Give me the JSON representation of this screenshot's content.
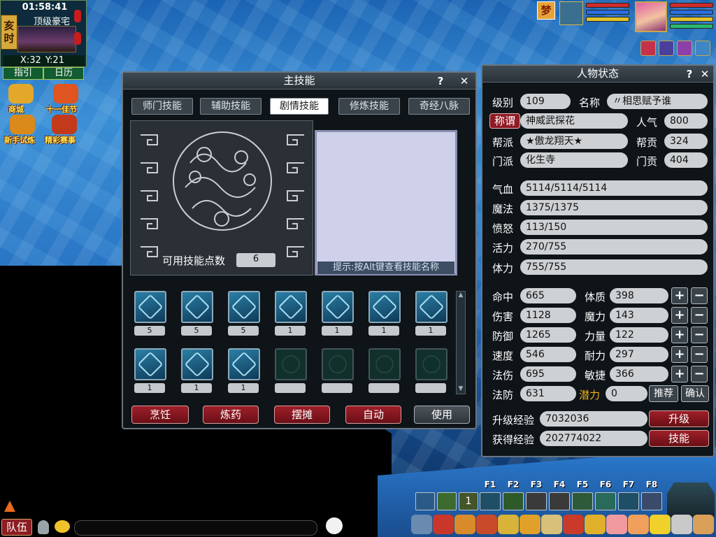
{
  "hud": {
    "clock": "01:58:41",
    "map_name": "顶级豪宅",
    "time_period": [
      "亥",
      "时"
    ],
    "coords_x": "X:32",
    "coords_y": "Y:21",
    "guide_label": "指引",
    "calendar_label": "日历",
    "activities": [
      {
        "label": "商城",
        "icon": "mall-icon",
        "color": "#e3a82a"
      },
      {
        "label": "十一佳节",
        "icon": "lantern-icon",
        "color": "#e0541f"
      },
      {
        "label": "新手试炼",
        "icon": "pagoda-icon",
        "color": "#d98a1a"
      },
      {
        "label": "精彩赛事",
        "icon": "drum-icon",
        "color": "#c23a1a"
      }
    ]
  },
  "status_top": {
    "pet_badge": "梦",
    "bar_colors": [
      "#d22b2b",
      "#2b6fe0",
      "#e3c32a"
    ],
    "shortcut_colors": [
      "#c4314b",
      "#4a3f9b",
      "#8c3fa8",
      "#3f86c4"
    ]
  },
  "skills_window": {
    "title": "主技能",
    "help": "?",
    "close": "✕",
    "tabs": [
      "师门技能",
      "辅助技能",
      "剧情技能",
      "修炼技能",
      "奇经八脉"
    ],
    "active_tab": "剧情技能",
    "points_label": "可用技能点数",
    "points_value": "6",
    "hint": "提示:按Alt键查看技能名称",
    "skill_levels_row1": [
      "5",
      "5",
      "5",
      "1",
      "1",
      "1",
      "1"
    ],
    "skill_levels_row2": [
      "1",
      "1",
      "1",
      "",
      "",
      "",
      ""
    ],
    "skill_icons_row1": [
      "skill-glyph-1-icon",
      "skill-glyph-2-icon",
      "skill-glyph-3-icon",
      "skill-glyph-4-icon",
      "skill-glyph-5-icon",
      "skill-glyph-6-icon",
      "skill-glyph-7-icon"
    ],
    "skill_icons_row2": [
      "sword-skill-icon",
      "wings-skill-icon",
      "tower-skill-icon",
      "empty-slot-icon",
      "empty-slot-icon",
      "empty-slot-icon",
      "empty-slot-icon"
    ],
    "buttons": [
      "烹饪",
      "炼药",
      "摆摊",
      "自动"
    ],
    "use_button": "使用"
  },
  "character_window": {
    "title": "人物状态",
    "help": "?",
    "close": "✕",
    "level_label": "级别",
    "level": "109",
    "name_label": "名称",
    "name": "〃相思赋予谁",
    "title_btn": "称谓",
    "title_value": "神威武探花",
    "popularity_label": "人气",
    "popularity": "800",
    "guild_label": "帮派",
    "guild": "★傲龙翔天★",
    "guild_contrib_label": "帮贡",
    "guild_contrib": "324",
    "sect_label": "门派",
    "sect": "化生寺",
    "sect_contrib_label": "门贡",
    "sect_contrib": "404",
    "hp_label": "气血",
    "hp": "5114/5114/5114",
    "mp_label": "魔法",
    "mp": "1375/1375",
    "rage_label": "愤怒",
    "rage": "113/150",
    "vitality_label": "活力",
    "vitality": "270/755",
    "stamina_label": "体力",
    "stamina": "755/755",
    "stats_left": [
      {
        "label": "命中",
        "value": "665"
      },
      {
        "label": "伤害",
        "value": "1128"
      },
      {
        "label": "防御",
        "value": "1265"
      },
      {
        "label": "速度",
        "value": "546"
      },
      {
        "label": "法伤",
        "value": "695"
      },
      {
        "label": "法防",
        "value": "631"
      }
    ],
    "attrs_right": [
      {
        "label": "体质",
        "value": "398"
      },
      {
        "label": "魔力",
        "value": "143"
      },
      {
        "label": "力量",
        "value": "122"
      },
      {
        "label": "耐力",
        "value": "297"
      },
      {
        "label": "敏捷",
        "value": "366"
      }
    ],
    "plus": "+",
    "minus": "−",
    "potential_label": "潜力",
    "potential": "0",
    "recommend_btn": "推荐",
    "confirm_btn": "确认",
    "exp_needed_label": "升级经验",
    "exp_needed": "7032036",
    "levelup_btn": "升级",
    "exp_gained_label": "获得经验",
    "exp_gained": "202774022",
    "skills_btn": "技能"
  },
  "bottom": {
    "fkeys": [
      "F1",
      "F2",
      "F3",
      "F4",
      "F5",
      "F6",
      "F7",
      "F8"
    ],
    "left_hotbar_count": "1",
    "team_btn": "队伍",
    "dock_icons": [
      "sword-icon",
      "treasure-chest-icon",
      "bag-icon",
      "pet-icon",
      "merchant-icon",
      "gift-icon",
      "scroll-icon",
      "fan-icon",
      "bell-icon",
      "peach-icon",
      "handshake-icon",
      "smiley-icon",
      "pencil-icon",
      "house-icon"
    ]
  }
}
